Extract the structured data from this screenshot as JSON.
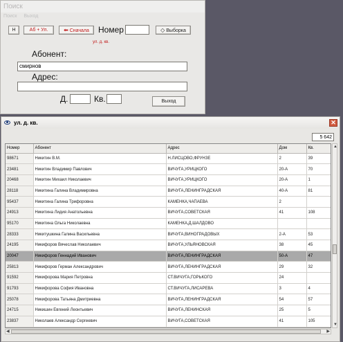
{
  "search": {
    "title": "Поиск",
    "menu": [
      "Поиск",
      "Выход"
    ],
    "btn_h": "Н",
    "btn_ab": "Аб + Ул.",
    "btn_back": "Сначала",
    "nomer_label": "Номер",
    "nomer_value": "",
    "btn_select": "Выборка",
    "street_hint": "ул. д. кв.",
    "abonent_label": "Абонент:",
    "abonent_value": "смирнов",
    "address_label": "Адрес:",
    "address_value": "",
    "house_label": "Д.",
    "house_value": "",
    "kv_label": "Кв.",
    "kv_value": "",
    "btn_exit": "Выход"
  },
  "results": {
    "title": "ул. д. кв.",
    "count": "5 642",
    "columns": [
      "Номер",
      "Абонент",
      "Адрес",
      "Дом",
      "Кв."
    ],
    "rows": [
      [
        "98671",
        "Никитин В.М.",
        "Н.ЛИСЦОВО,ФРУНЗЕ",
        "2",
        "39"
      ],
      [
        "23481",
        "Никитин Владимир Павлович",
        "ВИЧУГА,УРИЦКОГО",
        "20-А",
        "70"
      ],
      [
        "20468",
        "Никитин Михаил Николаевич",
        "ВИЧУГА,УРИЦКОГО",
        "20-А",
        "1"
      ],
      [
        "28118",
        "Никитина Галина Владимировна",
        "ВИЧУГА,ЛЕНИНГРАДСКАЯ",
        "40-А",
        "81"
      ],
      [
        "95437",
        "Никитина Галина Трифоровна",
        "КАМЕНКА,ЧАПАЕВА",
        "2",
        ""
      ],
      [
        "24913",
        "Никитина Лидия Анатольевна",
        "ВИЧУГА,СОВЕТСКАЯ",
        "41",
        "108"
      ],
      [
        "95170",
        "Никитина Ольга Николаевна",
        "КАМЕНКА,Д.ШАЛДОВО",
        "",
        ""
      ],
      [
        "28333",
        "Никитушкина Галина Васильевна",
        "ВИЧУГА,ВИНОГРАДОВЫХ",
        "2-А",
        "53"
      ],
      [
        "24195",
        "Никифоров Вячеслав Николаевич",
        "ВИЧУГА,УЛЬЯНОВСКАЯ",
        "38",
        "45"
      ],
      [
        "20047",
        "Никифоров Геннадий Иванович",
        "ВИЧУГА,ЛЕНИНГРАДСКАЯ",
        "50-А",
        "47"
      ],
      [
        "25813",
        "Никифоров Герман Александрович",
        "ВИЧУГА,ЛЕНИНГРАДСКАЯ",
        "29",
        "32"
      ],
      [
        "91592",
        "Никифорова Мария Петровна",
        "СТ.ВИЧУГА,ГОРЬКОГО",
        "24",
        ""
      ],
      [
        "91793",
        "Никифорова София Ивановна",
        "СТ.ВИЧУГА,ЛИСАРЕВА",
        "3",
        "4"
      ],
      [
        "25078",
        "Никифорова Татьяна Дмитриевна",
        "ВИЧУГА,ЛЕНИНГРАДСКАЯ",
        "54",
        "57"
      ],
      [
        "24715",
        "Никишин Евгений Леонтьевич",
        "ВИЧУГА,ЛЕНИНСКАЯ",
        "25",
        "5"
      ],
      [
        "23837",
        "Николаев Александр Сергеевич",
        "ВИЧУГА,СОВЕТСКАЯ",
        "41",
        "105"
      ]
    ],
    "selected_index": 9
  },
  "icons": {
    "title_icon": "eye-icon",
    "close": "close-icon",
    "back_arrow": "arrow-left-icon",
    "select_icon": "eraser-icon"
  },
  "colors": {
    "accent_red": "#c01818",
    "selected_row": "#a9a9a9",
    "close_button": "#d05a3e"
  }
}
